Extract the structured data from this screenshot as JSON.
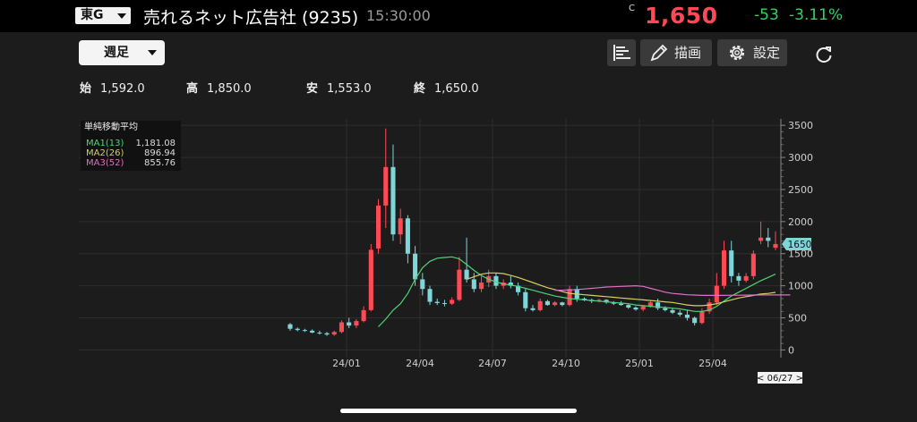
{
  "header": {
    "market": "東G",
    "name": "売れるネット広告社 (9235)",
    "time": "15:30:00",
    "price_flag": "C",
    "price": "1,650",
    "change": "-53",
    "change_pct": "-3.11%"
  },
  "toolbar": {
    "period": "週足",
    "draw_label": "描画",
    "settings_label": "設定"
  },
  "ohlc": [
    {
      "key": "始",
      "value": "1,592.0"
    },
    {
      "key": "高",
      "value": "1,850.0"
    },
    {
      "key": "安",
      "value": "1,553.0"
    },
    {
      "key": "終",
      "value": "1,650.0"
    }
  ],
  "legend": {
    "title": "単純移動平均",
    "items": [
      {
        "name": "MA1(13)",
        "value": "1,181.08",
        "color": "#4fd37a"
      },
      {
        "name": "MA2(26)",
        "value": "896.94",
        "color": "#d8d060"
      },
      {
        "name": "MA3(52)",
        "value": "855.76",
        "color": "#e070c8"
      }
    ]
  },
  "colors": {
    "up": "#ff4a55",
    "down": "#7fd6d8",
    "price_tag_bg": "#7fd6d8"
  },
  "chart_data": {
    "type": "candlestick",
    "y_ticks": [
      0,
      500,
      1000,
      1500,
      2000,
      2500,
      3000,
      3500
    ],
    "ylim": [
      -120,
      3600
    ],
    "x_ticks": [
      "24/01",
      "24/04",
      "24/07",
      "24/10",
      "25/01",
      "25/04"
    ],
    "last_price_tag": "1650",
    "date_tag": "< 06/27 >",
    "candles": [
      [
        400,
        420,
        300,
        330
      ],
      [
        330,
        350,
        290,
        310
      ],
      [
        310,
        330,
        280,
        300
      ],
      [
        300,
        320,
        260,
        270
      ],
      [
        270,
        300,
        240,
        260
      ],
      [
        260,
        280,
        220,
        240
      ],
      [
        240,
        300,
        220,
        280
      ],
      [
        280,
        460,
        260,
        430
      ],
      [
        430,
        500,
        340,
        380
      ],
      [
        380,
        480,
        340,
        450
      ],
      [
        450,
        680,
        430,
        620
      ],
      [
        620,
        1650,
        600,
        1560
      ],
      [
        1580,
        2350,
        1500,
        2250
      ],
      [
        2250,
        3450,
        1900,
        2850
      ],
      [
        2850,
        3200,
        1700,
        1800
      ],
      [
        1800,
        2200,
        1650,
        2050
      ],
      [
        2050,
        2100,
        1350,
        1500
      ],
      [
        1500,
        1620,
        1000,
        1100
      ],
      [
        1100,
        1200,
        850,
        950
      ],
      [
        950,
        1000,
        700,
        750
      ],
      [
        750,
        800,
        700,
        730
      ],
      [
        730,
        780,
        680,
        720
      ],
      [
        720,
        820,
        700,
        780
      ],
      [
        780,
        1450,
        760,
        1250
      ],
      [
        1250,
        1750,
        1050,
        1100
      ],
      [
        1100,
        1200,
        900,
        950
      ],
      [
        950,
        1150,
        900,
        1050
      ],
      [
        1050,
        1250,
        980,
        1150
      ],
      [
        1150,
        1200,
        950,
        1000
      ],
      [
        1000,
        1100,
        950,
        1050
      ],
      [
        1050,
        1150,
        960,
        1000
      ],
      [
        1000,
        1050,
        850,
        900
      ],
      [
        900,
        950,
        600,
        650
      ],
      [
        650,
        700,
        600,
        620
      ],
      [
        620,
        800,
        600,
        760
      ],
      [
        760,
        780,
        690,
        700
      ],
      [
        700,
        760,
        680,
        740
      ],
      [
        740,
        750,
        680,
        700
      ],
      [
        700,
        1000,
        680,
        950
      ],
      [
        950,
        1000,
        750,
        800
      ],
      [
        800,
        820,
        760,
        780
      ],
      [
        780,
        800,
        730,
        760
      ],
      [
        760,
        800,
        740,
        780
      ],
      [
        780,
        790,
        720,
        740
      ],
      [
        740,
        760,
        700,
        720
      ],
      [
        720,
        760,
        690,
        700
      ],
      [
        700,
        720,
        640,
        660
      ],
      [
        660,
        680,
        610,
        630
      ],
      [
        630,
        700,
        600,
        680
      ],
      [
        680,
        760,
        660,
        740
      ],
      [
        740,
        800,
        620,
        650
      ],
      [
        650,
        680,
        600,
        620
      ],
      [
        620,
        650,
        560,
        580
      ],
      [
        580,
        620,
        520,
        550
      ],
      [
        550,
        620,
        460,
        500
      ],
      [
        500,
        520,
        380,
        420
      ],
      [
        420,
        650,
        400,
        600
      ],
      [
        600,
        800,
        560,
        740
      ],
      [
        740,
        1200,
        700,
        1000
      ],
      [
        1000,
        1700,
        950,
        1550
      ],
      [
        1550,
        1700,
        1050,
        1150
      ],
      [
        1150,
        1200,
        1000,
        1080
      ],
      [
        1080,
        1200,
        1050,
        1150
      ],
      [
        1150,
        1550,
        1100,
        1500
      ],
      [
        1700,
        2000,
        1650,
        1750
      ],
      [
        1750,
        1900,
        1600,
        1700
      ],
      [
        1592,
        1850,
        1553,
        1650
      ]
    ],
    "ma1": [
      null,
      null,
      null,
      null,
      null,
      null,
      null,
      null,
      null,
      null,
      null,
      null,
      360,
      480,
      620,
      720,
      880,
      1100,
      1280,
      1380,
      1430,
      1440,
      1450,
      1420,
      1330,
      1240,
      1160,
      1100,
      1060,
      1030,
      1010,
      990,
      960,
      930,
      900,
      870,
      840,
      820,
      800,
      790,
      780,
      770,
      760,
      750,
      740,
      730,
      720,
      700,
      690,
      680,
      670,
      660,
      650,
      640,
      620,
      600,
      600,
      620,
      680,
      760,
      840,
      900,
      960,
      1020,
      1080,
      1130,
      1181
    ],
    "ma2": [
      null,
      null,
      null,
      null,
      null,
      null,
      null,
      null,
      null,
      null,
      null,
      null,
      null,
      null,
      null,
      null,
      null,
      null,
      null,
      null,
      null,
      null,
      null,
      null,
      1100,
      1140,
      1180,
      1200,
      1200,
      1190,
      1160,
      1130,
      1090,
      1050,
      1010,
      970,
      940,
      910,
      880,
      870,
      860,
      850,
      840,
      830,
      820,
      810,
      800,
      790,
      780,
      770,
      760,
      750,
      740,
      720,
      700,
      690,
      690,
      700,
      720,
      750,
      780,
      810,
      830,
      850,
      870,
      880,
      897
    ],
    "ma3": [
      null,
      null,
      null,
      null,
      null,
      null,
      null,
      null,
      null,
      null,
      null,
      null,
      null,
      null,
      null,
      null,
      null,
      null,
      null,
      null,
      null,
      null,
      null,
      null,
      null,
      null,
      null,
      null,
      null,
      null,
      null,
      null,
      null,
      null,
      null,
      null,
      930,
      930,
      935,
      940,
      950,
      960,
      970,
      980,
      985,
      990,
      995,
      1000,
      990,
      960,
      930,
      900,
      880,
      870,
      860,
      855,
      850,
      850,
      850,
      850,
      852,
      853,
      854,
      855,
      856,
      856,
      856,
      856,
      856
    ]
  }
}
